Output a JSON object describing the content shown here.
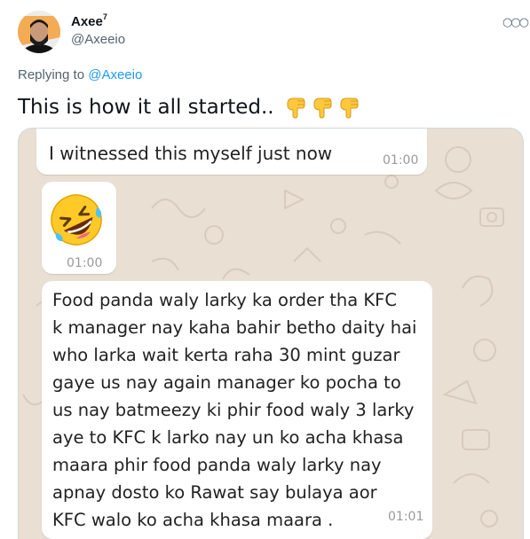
{
  "tweet": {
    "display_name": "Axee",
    "name_sup": "7",
    "handle": "@Axeeio",
    "reply_prefix": "Replying to",
    "reply_mention": "@Axeeio",
    "text": "This is how it all started..",
    "emojis": [
      "backhand-index-pointing-down",
      "backhand-index-pointing-down",
      "backhand-index-pointing-down"
    ],
    "more_icon": "more-horizontal-icon"
  },
  "chat": {
    "messages": [
      {
        "text": "I witnessed this myself just now",
        "time": "01:00"
      },
      {
        "emoji": "rolling-on-the-floor-laughing",
        "time": "01:00"
      },
      {
        "lines": [
          "Food panda waly larky ka order tha KFC",
          "k manager nay kaha bahir betho daity hai",
          "who larka wait kerta raha 30 mint guzar",
          "gaye us nay again manager ko pocha to",
          "us nay batmeezy ki phir food waly 3 larky",
          "aye to KFC k larko nay un ko acha khasa",
          "maara phir food panda waly larky nay",
          "apnay dosto ko Rawat say bulaya aor",
          "KFC walo ko acha khasa maara ."
        ],
        "time": "01:01"
      }
    ]
  },
  "colors": {
    "mention": "#1d9bf0",
    "secondary_text": "#536471",
    "wallpaper": "#e9dfd3"
  }
}
